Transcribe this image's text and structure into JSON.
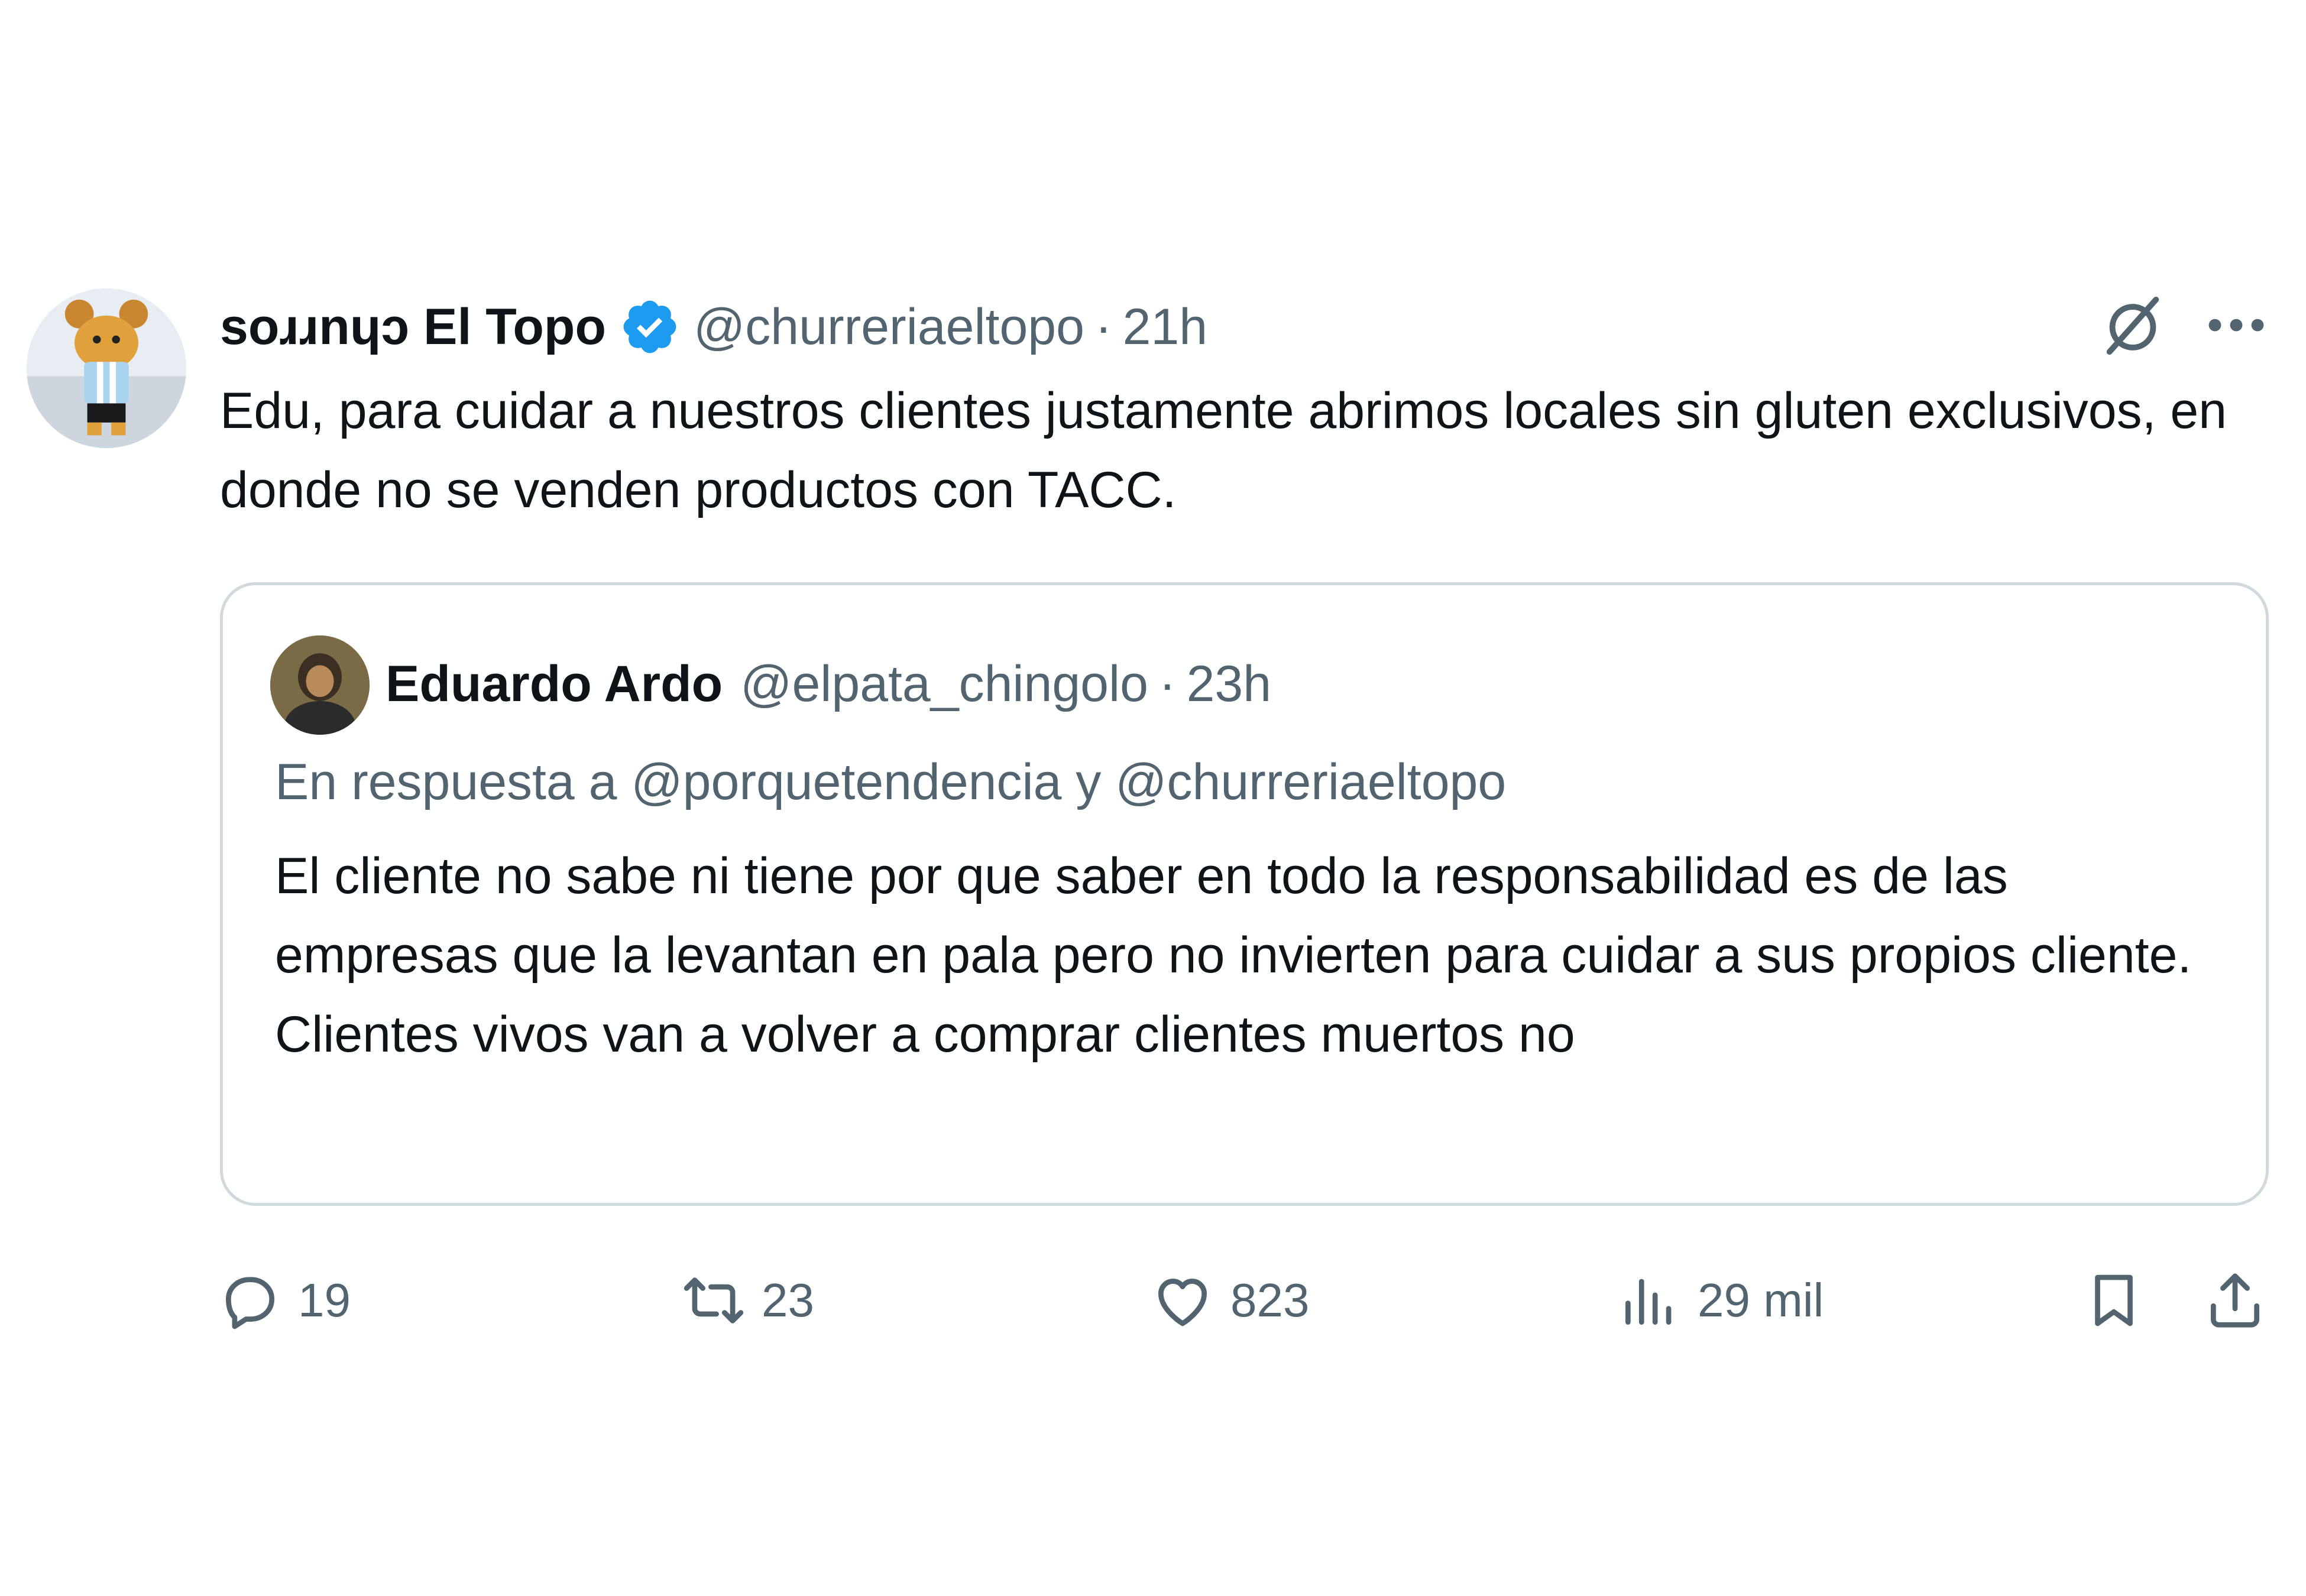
{
  "author": {
    "display_name": "soɹɹnɥɔ El Topo",
    "handle": "@churreriaeltopo",
    "separator": "·",
    "time": "21h",
    "verified": true,
    "avatar": "mascot-avatar"
  },
  "tweet": {
    "text": "Edu, para cuidar a nuestros clientes justamente abrimos locales sin gluten exclusivos, en donde no se venden productos con TACC."
  },
  "quote": {
    "display_name": "Eduardo Ardo",
    "handle": "@elpata_chingolo",
    "separator": "·",
    "time": "23h",
    "reply_to": "En respuesta a @porquetendencia y @churreriaeltopo",
    "text": "El cliente no sabe ni tiene por que saber en todo la responsabilidad es de las empresas que la levantan en pala pero no invierten para cuidar a sus propios cliente. Clientes vivos van a volver a comprar clientes muertos no"
  },
  "actions": {
    "replies": "19",
    "retweets": "23",
    "likes": "823",
    "views": "29 mil"
  },
  "icons": {
    "verified": "verified-badge-icon",
    "grok": "grok-icon",
    "more": "more-icon",
    "reply": "reply-icon",
    "retweet": "retweet-icon",
    "like": "heart-icon",
    "views": "views-icon",
    "bookmark": "bookmark-icon",
    "share": "share-icon"
  },
  "colors": {
    "text": "#0f1419",
    "secondary": "#536471",
    "verified": "#1d9bf0",
    "border": "#cfd9de"
  }
}
